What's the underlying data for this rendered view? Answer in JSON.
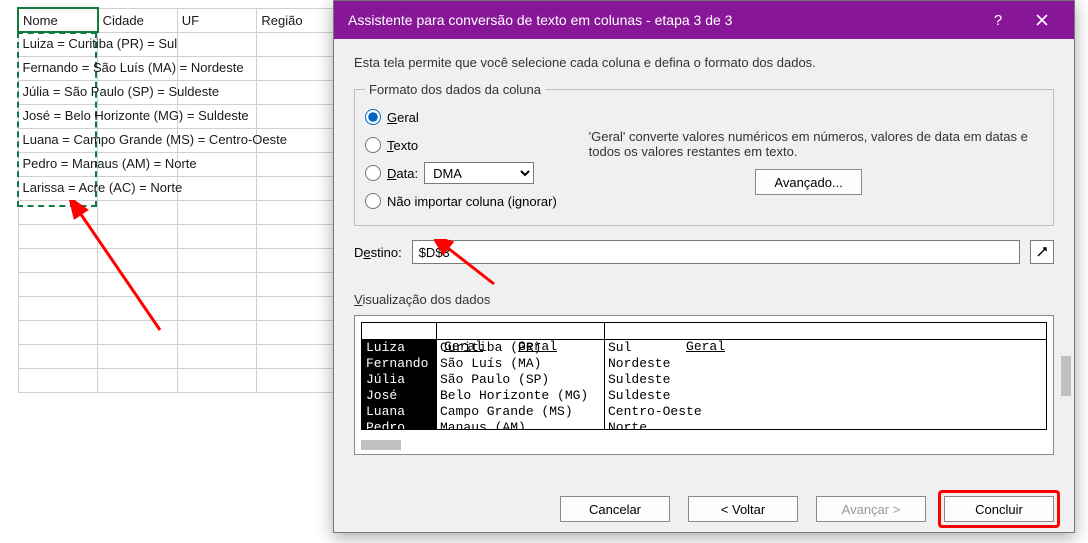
{
  "sheet": {
    "headers": [
      "Nome",
      "Cidade",
      "UF",
      "Região"
    ],
    "rows": [
      "Luiza = Curitiba (PR) = Sul",
      "Fernando = São Luís (MA) = Nordeste",
      "Júlia = São Paulo (SP) = Suldeste",
      "José = Belo Horizonte (MG) = Suldeste",
      "Luana = Campo Grande (MS) = Centro-Oeste",
      "Pedro = Manaus (AM) = Norte",
      "Larissa = Acre (AC) = Norte"
    ]
  },
  "dialog": {
    "title": "Assistente para conversão de texto em colunas - etapa 3 de 3",
    "intro": "Esta tela permite que você selecione cada coluna e defina o formato dos dados.",
    "group_legend": "Formato dos dados da coluna",
    "radios": {
      "geral": "Geral",
      "texto": "Texto",
      "data": "Data:",
      "ignorar": "Não importar coluna (ignorar)"
    },
    "data_format_option": "DMA",
    "convert_note": "'Geral' converte valores numéricos em números, valores de data em datas e todos os valores restantes em texto.",
    "advanced_btn": "Avançado...",
    "destino_label": "Destino:",
    "destino_value": "$D$3",
    "preview_label": "Visualização dos dados",
    "preview": {
      "headers": [
        "Geral",
        "Geral",
        "Geral"
      ],
      "rows": [
        [
          "Luiza",
          "Curitiba (PR)",
          "Sul"
        ],
        [
          "Fernando",
          "São Luís (MA)",
          "Nordeste"
        ],
        [
          "Júlia",
          "São Paulo (SP)",
          "Suldeste"
        ],
        [
          "José",
          "Belo Horizonte (MG)",
          "Suldeste"
        ],
        [
          "Luana",
          "Campo Grande (MS)",
          "Centro-Oeste"
        ],
        [
          "Pedro",
          "Manaus (AM)",
          "Norte"
        ]
      ]
    },
    "buttons": {
      "cancel": "Cancelar",
      "back": "< Voltar",
      "next": "Avançar >",
      "finish": "Concluir"
    }
  }
}
